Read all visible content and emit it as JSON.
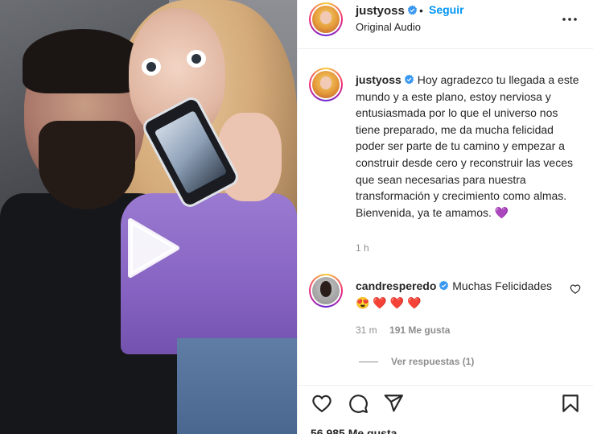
{
  "post": {
    "author": "justyoss",
    "follow_label": "Seguir",
    "separator": "•",
    "audio": "Original Audio",
    "caption": "Hoy agradezco tu llegada a este mundo y a este plano, estoy nerviosa y entusiasmada por lo que el universo nos tiene preparado, me da mucha felicidad poder ser parte de tu camino y empezar a construir desde cero y reconstruir las veces que sean necesarias para nuestra transformación y crecimiento como almas. Bienvenida, ya te amamos. 💜",
    "time": "1 h",
    "likes_partial": "56.985 Me gusta"
  },
  "comment": {
    "author": "candresperedo",
    "text": "Muchas Felicidades 😍 ❤️ ❤️ ❤️",
    "time": "31 m",
    "likes": "191 Me gusta",
    "view_replies": "Ver respuestas (1)"
  },
  "icons": {
    "verified": "verified-badge-icon",
    "more": "more-options-icon",
    "play": "play-icon",
    "like": "heart-icon",
    "comment": "comment-icon",
    "share": "share-icon",
    "save": "bookmark-icon"
  },
  "colors": {
    "accent": "#0095f6",
    "verified": "#3897f0",
    "muted": "#8e8e8e",
    "text": "#262626"
  }
}
